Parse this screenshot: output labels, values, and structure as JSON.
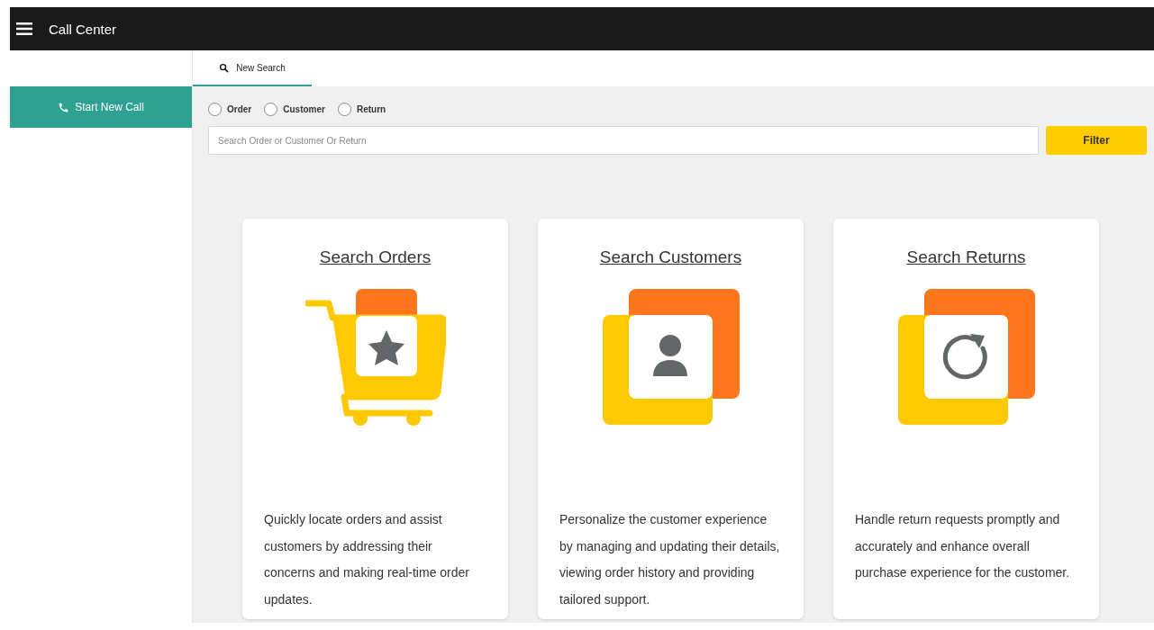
{
  "header": {
    "title": "Call Center"
  },
  "sidebar": {
    "start_button": "Start New Call"
  },
  "tabs": [
    {
      "label": "New Search",
      "selected": true
    }
  ],
  "search_types": [
    {
      "label": "Order",
      "selected": false
    },
    {
      "label": "Customer",
      "selected": false
    },
    {
      "label": "Return",
      "selected": false
    }
  ],
  "search": {
    "placeholder": "Search Order or Customer Or Return",
    "button": "Filter"
  },
  "cards": [
    {
      "kind": "orders",
      "title": "Search Orders",
      "description": "Quickly locate orders and assist customers by addressing their concerns and making real-time order updates."
    },
    {
      "kind": "customers",
      "title": "Search Customers",
      "description": "Personalize the customer experience by managing and updating their details, viewing order history and providing tailored support."
    },
    {
      "kind": "returns",
      "title": "Search Returns",
      "description": "Handle return requests promptly and accurately and enhance overall purchase experience for the customer."
    }
  ]
}
